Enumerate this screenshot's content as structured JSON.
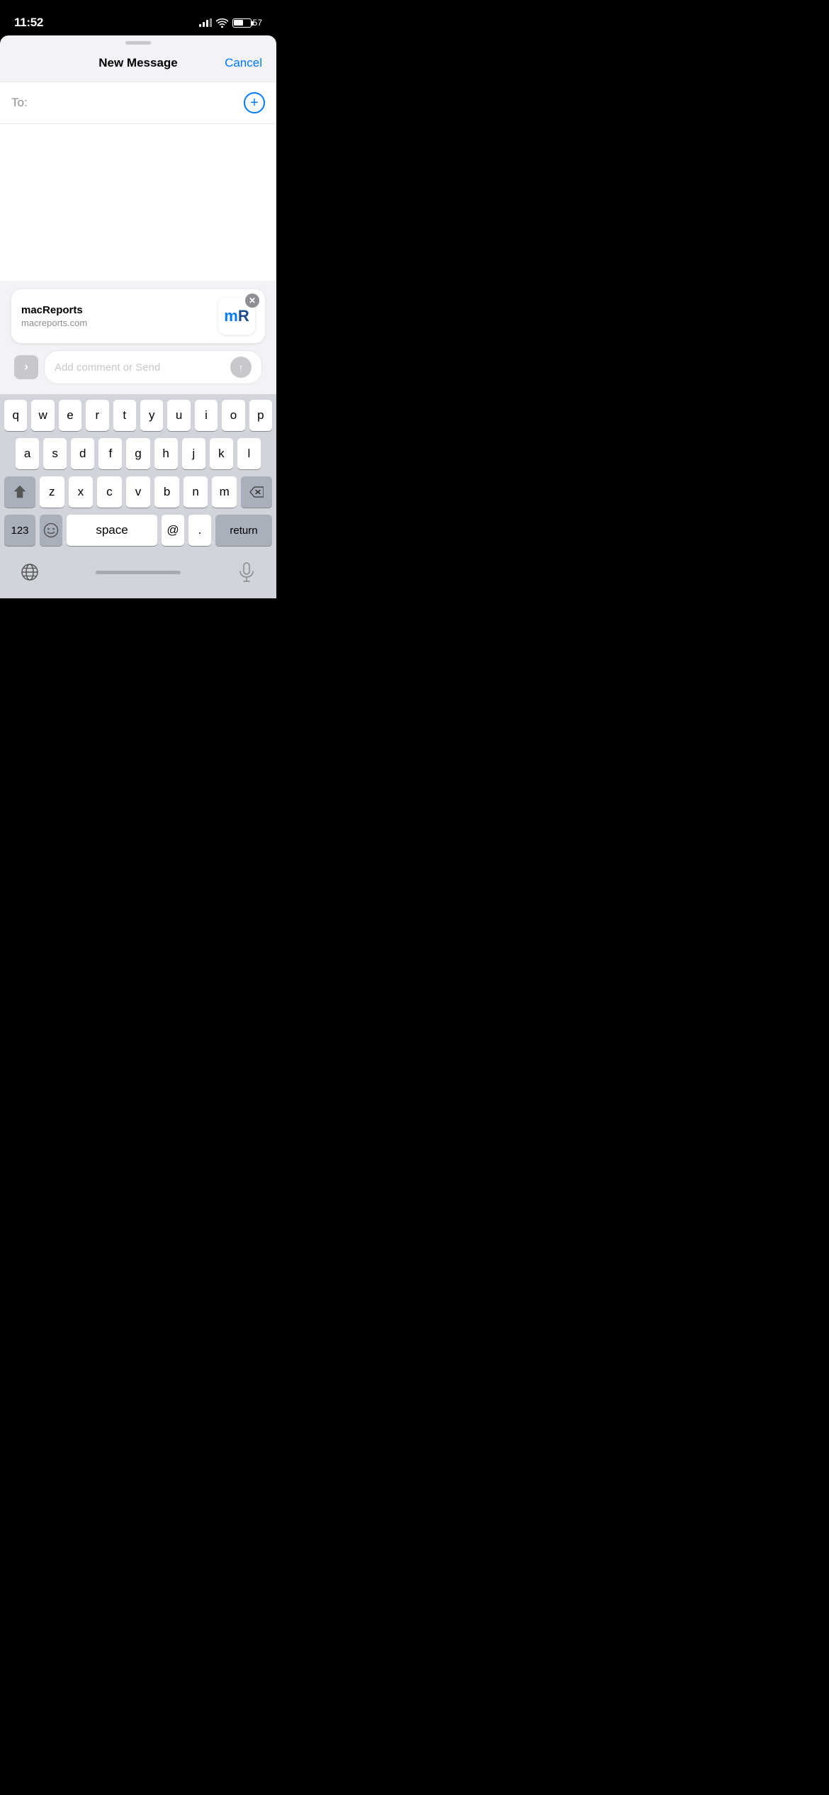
{
  "statusBar": {
    "time": "11:52",
    "battery": "57",
    "batteryIcon": "battery"
  },
  "header": {
    "title": "New Message",
    "cancelLabel": "Cancel"
  },
  "toField": {
    "label": "To:",
    "placeholder": ""
  },
  "shareCard": {
    "title": "macReports",
    "url": "macreports.com",
    "logoM": "m",
    "logoR": "R"
  },
  "commentInput": {
    "placeholder": "Add comment or Send"
  },
  "keyboard": {
    "row1": [
      "q",
      "w",
      "e",
      "r",
      "t",
      "y",
      "u",
      "i",
      "o",
      "p"
    ],
    "row2": [
      "a",
      "s",
      "d",
      "f",
      "g",
      "h",
      "j",
      "k",
      "l"
    ],
    "row3": [
      "z",
      "x",
      "c",
      "v",
      "b",
      "n",
      "m"
    ],
    "row4": {
      "numbers": "123",
      "space": "space",
      "at": "@",
      "dot": ".",
      "return": "return"
    }
  }
}
